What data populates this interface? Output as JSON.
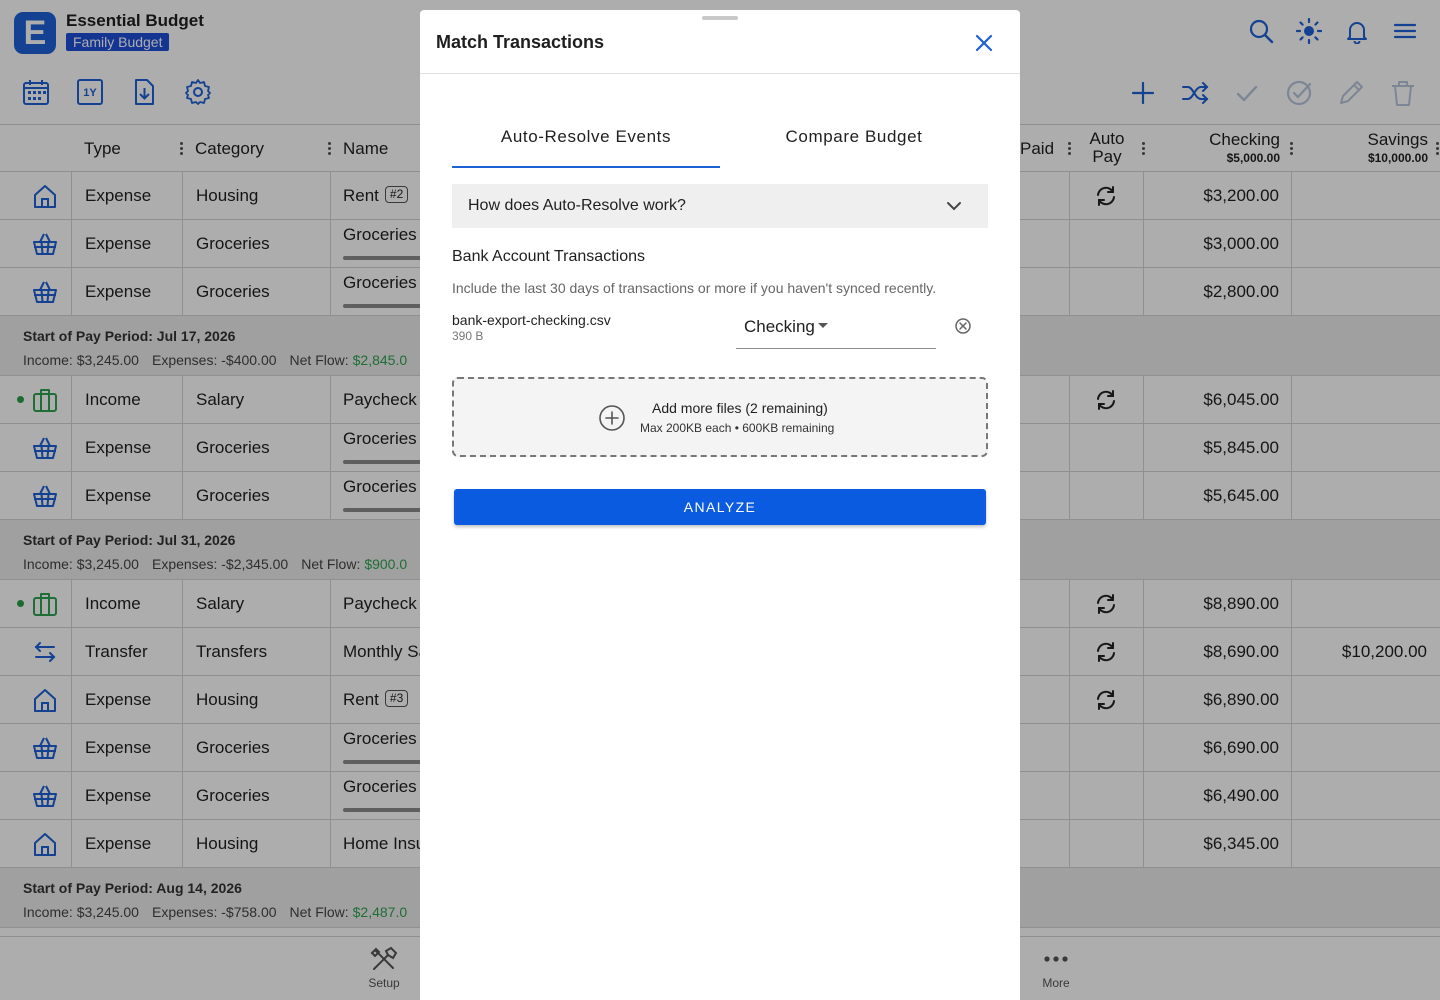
{
  "app": {
    "logo_letter": "E",
    "title": "Essential Budget",
    "budget_name": "Family Budget"
  },
  "toolbar": {
    "year_label": "1Y"
  },
  "table": {
    "headers": {
      "type": "Type",
      "category": "Category",
      "name": "Name",
      "paid": "Paid",
      "auto_pay_line1": "Auto",
      "auto_pay_line2": "Pay",
      "checking": "Checking",
      "checking_balance": "$5,000.00",
      "savings": "Savings",
      "savings_balance": "$10,000.00"
    },
    "rows": [
      {
        "icon": "house-icon",
        "type": "Expense",
        "category": "Housing",
        "name": "Rent",
        "tag": "#2",
        "auto": true,
        "checking": "$3,200.00",
        "savings": ""
      },
      {
        "icon": "basket-icon",
        "type": "Expense",
        "category": "Groceries",
        "name": "Groceries",
        "tag": "",
        "auto": false,
        "checking": "$3,000.00",
        "savings": ""
      },
      {
        "icon": "basket-icon",
        "type": "Expense",
        "category": "Groceries",
        "name": "Groceries",
        "tag": "",
        "auto": false,
        "checking": "$2,800.00",
        "savings": ""
      },
      {
        "period": true,
        "title": "Start of Pay Period: Jul 17, 2026",
        "income": "Income: $3,245.00",
        "expenses": "Expenses: -$400.00",
        "net_label": "Net Flow:",
        "net_value": "$2,845.0"
      },
      {
        "icon": "briefcase-icon",
        "dot": true,
        "type": "Income",
        "category": "Salary",
        "name": "Paycheck",
        "tag": "",
        "auto": true,
        "checking": "$6,045.00",
        "savings": ""
      },
      {
        "icon": "basket-icon",
        "type": "Expense",
        "category": "Groceries",
        "name": "Groceries",
        "tag": "",
        "auto": false,
        "checking": "$5,845.00",
        "savings": ""
      },
      {
        "icon": "basket-icon",
        "type": "Expense",
        "category": "Groceries",
        "name": "Groceries",
        "tag": "",
        "auto": false,
        "checking": "$5,645.00",
        "savings": ""
      },
      {
        "period": true,
        "title": "Start of Pay Period: Jul 31, 2026",
        "income": "Income: $3,245.00",
        "expenses": "Expenses: -$2,345.00",
        "net_label": "Net Flow:",
        "net_value": "$900.0"
      },
      {
        "icon": "briefcase-icon",
        "dot": true,
        "type": "Income",
        "category": "Salary",
        "name": "Paycheck",
        "tag": "",
        "auto": true,
        "checking": "$8,890.00",
        "savings": ""
      },
      {
        "icon": "transfer-icon",
        "type": "Transfer",
        "category": "Transfers",
        "name": "Monthly Sa",
        "tag": "",
        "auto": true,
        "checking": "$8,690.00",
        "savings": "$10,200.00"
      },
      {
        "icon": "house-icon",
        "type": "Expense",
        "category": "Housing",
        "name": "Rent",
        "tag": "#3",
        "auto": true,
        "checking": "$6,890.00",
        "savings": ""
      },
      {
        "icon": "basket-icon",
        "type": "Expense",
        "category": "Groceries",
        "name": "Groceries",
        "tag": "",
        "auto": false,
        "checking": "$6,690.00",
        "savings": ""
      },
      {
        "icon": "basket-icon",
        "type": "Expense",
        "category": "Groceries",
        "name": "Groceries",
        "tag": "",
        "auto": false,
        "checking": "$6,490.00",
        "savings": ""
      },
      {
        "icon": "house-icon",
        "type": "Expense",
        "category": "Housing",
        "name": "Home Insu",
        "tag": "",
        "auto": false,
        "checking": "$6,345.00",
        "savings": ""
      },
      {
        "period": true,
        "title": "Start of Pay Period: Aug 14, 2026",
        "income": "Income: $3,245.00",
        "expenses": "Expenses: -$758.00",
        "net_label": "Net Flow:",
        "net_value": "$2,487.0"
      }
    ]
  },
  "bottom_nav": {
    "setup": "Setup",
    "more": "More"
  },
  "dialog": {
    "title": "Match Transactions",
    "tabs": [
      {
        "label": "Auto-Resolve Events",
        "active": true
      },
      {
        "label": "Compare Budget",
        "active": false
      }
    ],
    "accordion_question": "How does Auto-Resolve work?",
    "section_title": "Bank Account Transactions",
    "section_help": "Include the last 30 days of transactions or more if you haven't synced recently.",
    "file": {
      "name": "bank-export-checking.csv",
      "size": "390 B",
      "account": "Checking"
    },
    "dropzone": {
      "line1": "Add more files (2 remaining)",
      "line2": "Max 200KB each • 600KB remaining"
    },
    "analyze_label": "ANALYZE"
  },
  "colors": {
    "accent": "#1e60d6",
    "button": "#0a5be0",
    "positive": "#2fa34e",
    "period_bg": "#ececec"
  }
}
